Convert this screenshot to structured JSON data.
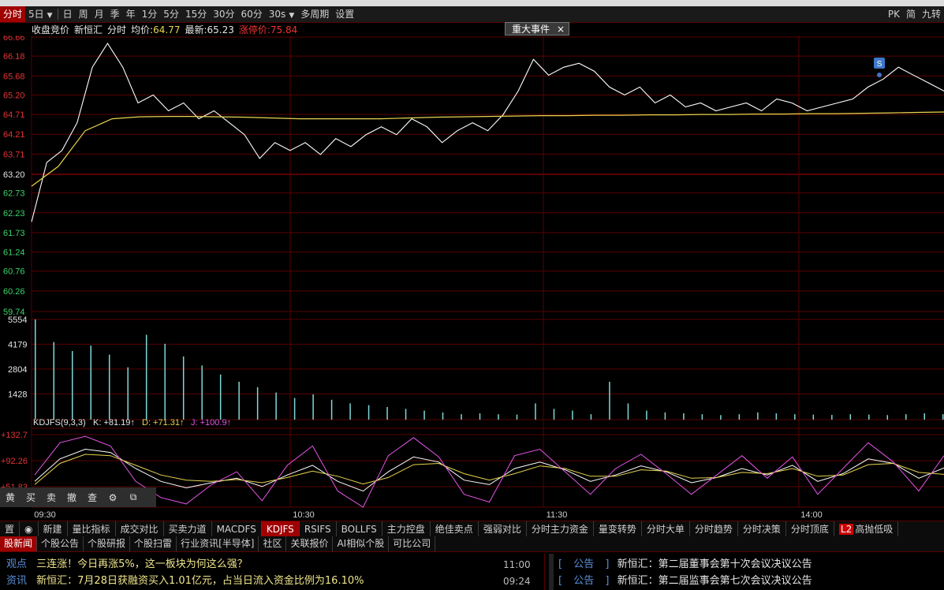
{
  "toolbar": {
    "items": [
      {
        "label": "分时",
        "active": true
      },
      {
        "label": "5日",
        "caret": true
      },
      {
        "label": "日"
      },
      {
        "label": "周"
      },
      {
        "label": "月"
      },
      {
        "label": "季"
      },
      {
        "label": "年"
      },
      {
        "label": "1分"
      },
      {
        "label": "5分"
      },
      {
        "label": "15分"
      },
      {
        "label": "30分"
      },
      {
        "label": "60分"
      },
      {
        "label": "30s",
        "caret": true
      },
      {
        "label": "多周期"
      },
      {
        "label": "设置"
      }
    ],
    "right": [
      "PK",
      "简",
      "九转"
    ]
  },
  "info": {
    "auction": "收盘竞价",
    "stock": "新恒汇",
    "mode": "分时",
    "avg_label": "均价:",
    "avg_value": "64.77",
    "last_label": "最新:",
    "last_value": "65.23",
    "limit_label": "涨停价:",
    "limit_value": "75.84"
  },
  "event_box": {
    "label": "重大事件",
    "close": "×"
  },
  "kdj_header": {
    "name": "KDJFS(9,3,3)",
    "k": "K: +81.19↑",
    "d": "D: +71.31↑",
    "j": "J: +100.9↑"
  },
  "signal_marker": "S",
  "colors": {
    "price": "#ffffff",
    "avg": "#e8d44d",
    "up": "#e33333",
    "grid": "#5a0000",
    "vol": "#7fd8d8",
    "k": "#ffffff",
    "d": "#e8d44d",
    "j": "#e455e4"
  },
  "chart_data": {
    "type": "line",
    "price_axis": [
      "66.66",
      "66.18",
      "65.68",
      "65.20",
      "64.71",
      "64.21",
      "63.71",
      "63.20",
      "62.73",
      "62.23",
      "61.73",
      "61.24",
      "60.76",
      "60.26",
      "59.74"
    ],
    "ylim": [
      59.74,
      66.66
    ],
    "reference_price": 63.2,
    "time_ticks": [
      "09:30",
      "10:30",
      "11:30",
      "14:00"
    ],
    "volume_axis": [
      "5554",
      "4179",
      "2804",
      "1428"
    ],
    "kdj_axis": [
      "+132.7",
      "+92.26",
      "+51.83"
    ],
    "series": [
      {
        "name": "价格",
        "values": [
          62.0,
          63.5,
          63.8,
          64.5,
          65.9,
          66.5,
          65.9,
          65.0,
          65.2,
          64.8,
          65.0,
          64.6,
          64.8,
          64.5,
          64.2,
          63.6,
          64.0,
          63.8,
          64.0,
          63.7,
          64.1,
          63.9,
          64.2,
          64.4,
          64.2,
          64.6,
          64.4,
          64.0,
          64.3,
          64.5,
          64.3,
          64.7,
          65.3,
          66.1,
          65.7,
          65.9,
          66.0,
          65.8,
          65.4,
          65.2,
          65.4,
          65.0,
          65.2,
          64.9,
          65.0,
          64.8,
          64.9,
          65.0,
          64.8,
          65.1,
          65.0,
          64.8,
          64.9,
          65.0,
          65.1,
          65.4,
          65.6,
          65.9,
          65.7,
          65.5,
          65.3
        ]
      },
      {
        "name": "均价",
        "values": [
          62.9,
          63.4,
          64.3,
          64.6,
          64.65,
          64.66,
          64.66,
          64.65,
          64.64,
          64.62,
          64.6,
          64.6,
          64.6,
          64.6,
          64.62,
          64.64,
          64.65,
          64.66,
          64.67,
          64.68,
          64.68,
          64.69,
          64.69,
          64.7,
          64.7,
          64.71,
          64.71,
          64.72,
          64.72,
          64.73,
          64.73,
          64.74,
          64.75,
          64.76,
          64.77
        ]
      },
      {
        "name": "成交量",
        "values": [
          5554,
          4300,
          3800,
          4100,
          3600,
          2900,
          4700,
          4200,
          3500,
          3000,
          2500,
          2100,
          1800,
          1500,
          1200,
          1400,
          1100,
          900,
          800,
          700,
          600,
          500,
          400,
          300,
          350,
          300,
          280,
          900,
          600,
          500,
          300,
          2100,
          900,
          500,
          400,
          350,
          300,
          250,
          300,
          400,
          350,
          300,
          280,
          260,
          300,
          280,
          250,
          300,
          350,
          300
        ]
      },
      {
        "name": "K",
        "values": [
          60,
          95,
          110,
          105,
          80,
          60,
          50,
          58,
          65,
          52,
          70,
          85,
          60,
          45,
          75,
          98,
          90,
          62,
          55,
          80,
          90,
          78,
          60,
          70,
          84,
          75,
          58,
          66,
          80,
          70,
          85,
          60,
          72,
          95,
          88,
          65,
          81
        ]
      },
      {
        "name": "D",
        "values": [
          55,
          88,
          102,
          100,
          85,
          70,
          62,
          60,
          63,
          58,
          66,
          76,
          68,
          56,
          66,
          86,
          88,
          72,
          62,
          72,
          84,
          80,
          68,
          68,
          78,
          76,
          65,
          66,
          74,
          72,
          80,
          68,
          70,
          86,
          88,
          74,
          71
        ]
      },
      {
        "name": "J",
        "values": [
          70,
          120,
          130,
          115,
          60,
          35,
          25,
          55,
          75,
          30,
          85,
          115,
          45,
          20,
          100,
          128,
          98,
          40,
          28,
          100,
          110,
          75,
          40,
          80,
          102,
          72,
          40,
          70,
          100,
          65,
          98,
          40,
          80,
          120,
          90,
          45,
          100
        ]
      }
    ]
  },
  "toolpanel": [
    "黄",
    "买",
    "卖",
    "撤",
    "查",
    "⚙",
    "⧉"
  ],
  "indicator_tabs": {
    "settings": "置",
    "items": [
      "新建",
      "量比指标",
      "成交对比",
      "买卖力道",
      "MACDFS",
      "KDJFS",
      "RSIFS",
      "BOLLFS",
      "主力控盘",
      "绝佳卖点",
      "强弱对比",
      "分时主力资金",
      "量变转势",
      "分时大单",
      "分时趋势",
      "分时决策",
      "分时顶底"
    ],
    "active": "KDJFS",
    "l2_badge": "L2",
    "last": "高抛低吸"
  },
  "news_tabs": {
    "items": [
      "股新闻",
      "个股公告",
      "个股研报",
      "个股扫雷",
      "行业资讯[半导体]",
      "社区",
      "关联报价",
      "AI相似个股",
      "可比公司"
    ],
    "active": "股新闻"
  },
  "news_left": [
    {
      "tag": "观点",
      "title": "三连涨！今日再涨5%，这一板块为何这么强？",
      "time": "11:00"
    },
    {
      "tag": "资讯",
      "title": "新恒汇：7月28日获融资买入1.01亿元，占当日流入资金比例为16.10%",
      "time": "09:24"
    }
  ],
  "news_right": [
    {
      "tag": "公告",
      "title": "新恒汇：第二届董事会第十次会议决议公告"
    },
    {
      "tag": "公告",
      "title": "新恒汇：第二届监事会第七次会议决议公告"
    }
  ]
}
